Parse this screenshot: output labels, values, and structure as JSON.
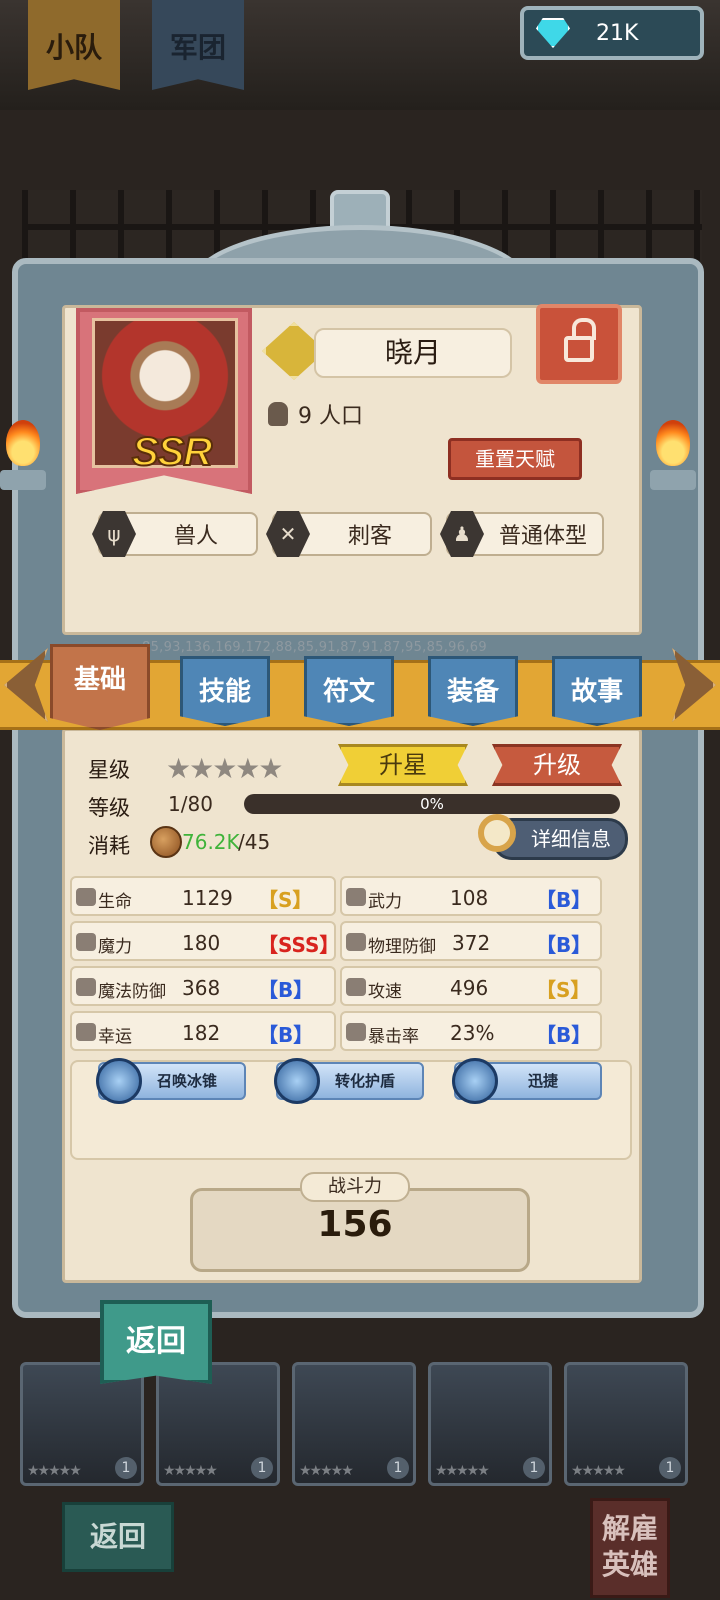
{
  "top_tabs": {
    "squad": "小队",
    "legion": "军团"
  },
  "currency": {
    "gems": "21K",
    "icon": "diamond-icon"
  },
  "hero": {
    "name": "晓月",
    "rarity": "SSR",
    "population": "9 人口",
    "reset_label": "重置天赋",
    "traits": [
      "兽人",
      "刺客",
      "普通体型"
    ]
  },
  "faded_numbers": "85,93,136,169,172,88,85,91,87,91,87,95,85,96,69",
  "tabs": [
    "基础",
    "技能",
    "符文",
    "装备",
    "故事"
  ],
  "stats_panel": {
    "star_label": "星级",
    "stars": "★★★★★",
    "star_up_label": "升星",
    "level_up_label": "升级",
    "level_label": "等级",
    "level_value": "1/80",
    "xp_percent": "0%",
    "xp_fraction": 0,
    "cost_label": "消耗",
    "cost_have": "76.2K",
    "cost_need": "/45",
    "detail_label": "详细信息"
  },
  "stats": [
    {
      "name": "生命",
      "value": "1129",
      "grade": "【S】"
    },
    {
      "name": "武力",
      "value": "108",
      "grade": "【B】"
    },
    {
      "name": "魔力",
      "value": "180",
      "grade": "【SSS】"
    },
    {
      "name": "物理防御",
      "value": "372",
      "grade": "【B】"
    },
    {
      "name": "魔法防御",
      "value": "368",
      "grade": "【B】"
    },
    {
      "name": "攻速",
      "value": "496",
      "grade": "【S】"
    },
    {
      "name": "幸运",
      "value": "182",
      "grade": "【B】"
    },
    {
      "name": "暴击率",
      "value": "23%",
      "grade": "【B】"
    }
  ],
  "skills": [
    "召唤冰锥",
    "转化护盾",
    "迅捷"
  ],
  "power": {
    "label": "战斗力",
    "value": "156"
  },
  "back_label": "返回",
  "bottom": {
    "back_label": "返回",
    "dismiss_label": "解雇英雄",
    "card_levels": [
      "1",
      "1",
      "1",
      "1",
      "1"
    ],
    "card_stars": "★★★★★"
  }
}
